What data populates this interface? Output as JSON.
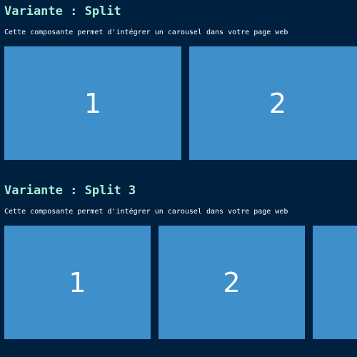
{
  "sections": [
    {
      "title": "Variante : Split",
      "description": "Cette composante permet d'intégrer un carousel dans votre page web",
      "slides": [
        {
          "label": "1"
        },
        {
          "label": "2"
        }
      ]
    },
    {
      "title": "Variante : Split 3",
      "description": "Cette composante permet d'intégrer un carousel dans votre page web",
      "slides": [
        {
          "label": "1"
        },
        {
          "label": "2"
        },
        {
          "label": ""
        }
      ]
    }
  ],
  "colors": {
    "background": "#002040",
    "title": "#a6f0d6",
    "slide": "#3f8fcb",
    "text": "#ffffff"
  }
}
